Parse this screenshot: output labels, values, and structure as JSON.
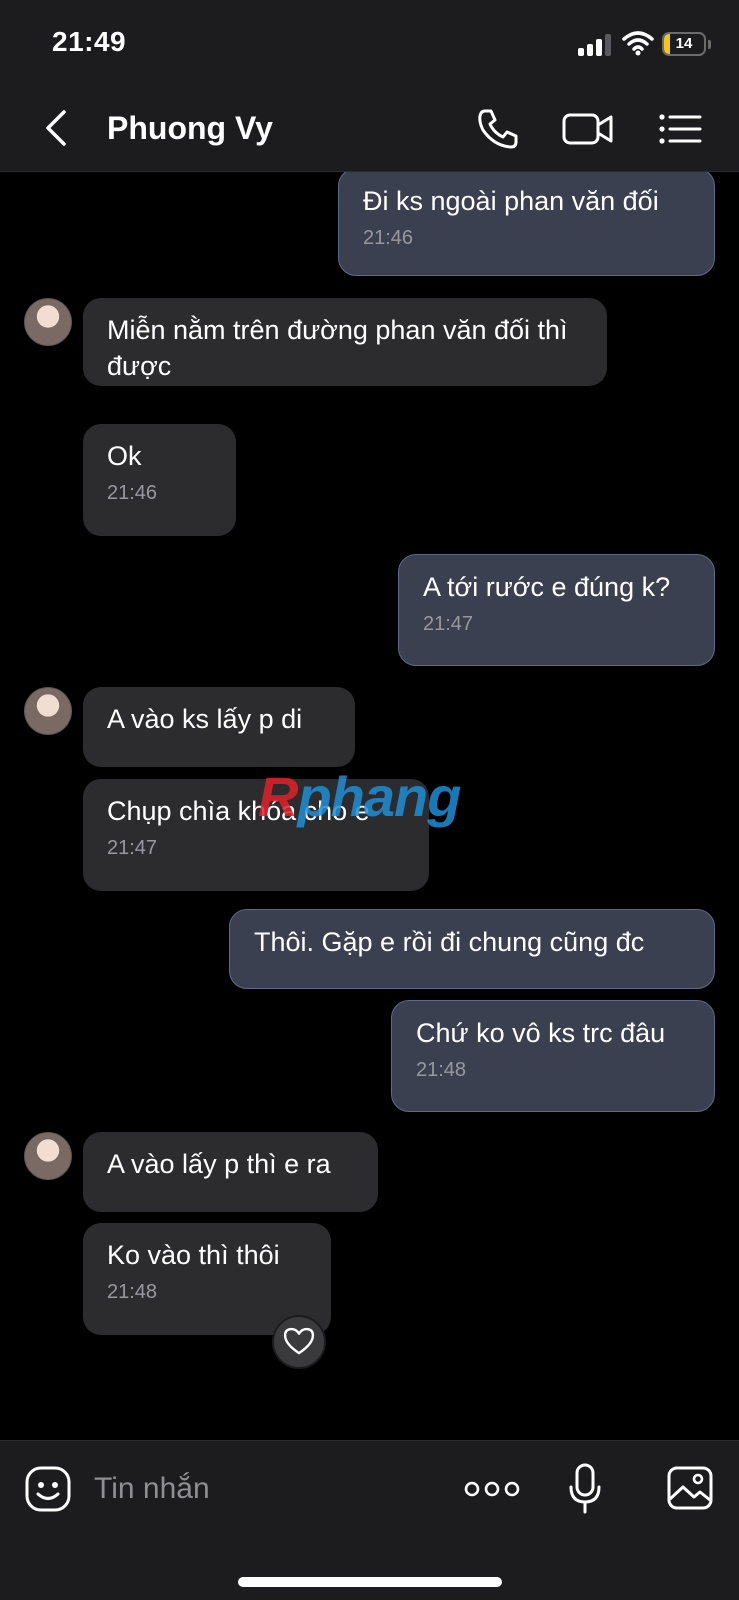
{
  "status_bar": {
    "time": "21:49",
    "battery": "14"
  },
  "header": {
    "contact_name": "Phuong Vy"
  },
  "watermark": {
    "part1": "R",
    "part2": "phang"
  },
  "messages": [
    {
      "direction": "out",
      "text": "Đi ks ngoài phan văn đối",
      "time": "21:46"
    },
    {
      "direction": "in",
      "text": "Miễn nằm trên đường phan văn đối thì được",
      "time": ""
    },
    {
      "direction": "in",
      "text": "Ok",
      "time": "21:46"
    },
    {
      "direction": "out",
      "text": "A tới rước e đúng k?",
      "time": "21:47"
    },
    {
      "direction": "in",
      "text": "A vào ks lấy p di",
      "time": ""
    },
    {
      "direction": "in",
      "text": "Chụp chìa khóa cho e",
      "time": "21:47"
    },
    {
      "direction": "out",
      "text": "Thôi. Gặp e rồi đi chung cũng đc",
      "time": ""
    },
    {
      "direction": "out",
      "text": "Chứ ko vô ks trc đâu",
      "time": "21:48"
    },
    {
      "direction": "in",
      "text": "A vào lấy p thì e ra",
      "time": ""
    },
    {
      "direction": "in",
      "text": "Ko vào thì thôi",
      "time": "21:48"
    }
  ],
  "reaction": {
    "icon": "heart-icon"
  },
  "input_bar": {
    "placeholder": "Tin nhắn"
  },
  "colors": {
    "incoming_bubble": "#2c2c2e",
    "outgoing_bubble": "#3a4050",
    "outgoing_border": "#5c6a8a",
    "battery_fill": "#f5c518"
  }
}
